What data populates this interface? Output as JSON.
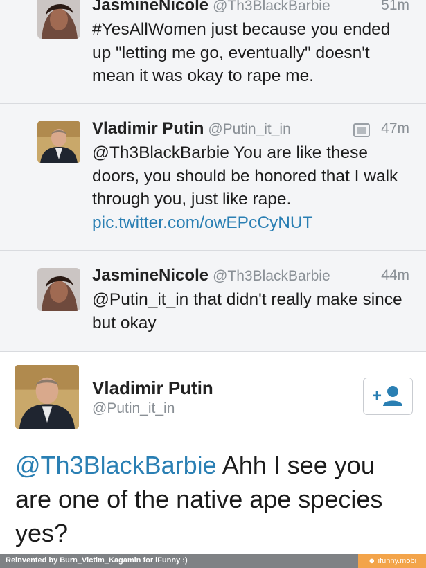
{
  "tweets": [
    {
      "name": "JasmineNicole",
      "handle": "@Th3BlackBarbie",
      "time": "51m",
      "text": "#YesAllWomen just because you ended up \"letting me go, eventually\" doesn't mean it was okay to rape me."
    },
    {
      "name": "Vladimir Putin",
      "handle": "@Putin_it_in",
      "time": "47m",
      "text": "@Th3BlackBarbie You are like these doors, you should be honored that I walk through you, just like rape.",
      "link": "pic.twitter.com/owEPcCyNUT"
    },
    {
      "name": "JasmineNicole",
      "handle": "@Th3BlackBarbie",
      "time": "44m",
      "text": "@Putin_it_in that didn't really make since but okay"
    }
  ],
  "main_tweet": {
    "name": "Vladimir Putin",
    "handle": "@Putin_it_in",
    "mention": "@Th3BlackBarbie",
    "text": " Ahh I see you are one of the native ape species yes?"
  },
  "footer": {
    "credit": "Reinvented by Burn_Victim_Kagamin for iFunny :)",
    "site": "ifunny.mobi"
  },
  "colors": {
    "link": "#2a7fb3",
    "muted": "#8a9096",
    "timeline_bg": "#f4f5f7",
    "brand_orange": "#f3a44a"
  },
  "icons": [
    "media-icon",
    "follow-icon",
    "ifunny-smiley-icon"
  ]
}
